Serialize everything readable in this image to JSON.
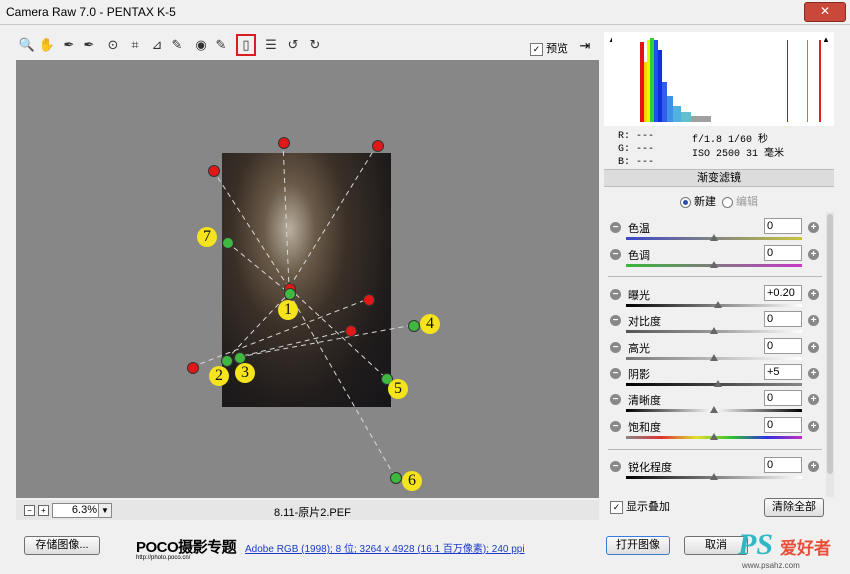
{
  "window": {
    "title": "Camera Raw 7.0 -  PENTAX K-5",
    "close_glyph": "✕"
  },
  "toolbar": {
    "tools": [
      {
        "name": "zoom-tool",
        "glyph": "🔍"
      },
      {
        "name": "hand-tool",
        "glyph": "✋"
      },
      {
        "name": "white-balance-tool",
        "glyph": "✒"
      },
      {
        "name": "color-sampler-tool",
        "glyph": "✒"
      },
      {
        "name": "targeted-adjustment-tool",
        "glyph": "⊙"
      },
      {
        "name": "crop-tool",
        "glyph": "⌗"
      },
      {
        "name": "straighten-tool",
        "glyph": "⊿"
      },
      {
        "name": "spot-removal-tool",
        "glyph": "✎"
      },
      {
        "name": "red-eye-tool",
        "glyph": "◉"
      },
      {
        "name": "adjustment-brush-tool",
        "glyph": "✎"
      },
      {
        "name": "graduated-filter-tool",
        "glyph": "▯"
      },
      {
        "name": "preferences-tool",
        "glyph": "☰"
      },
      {
        "name": "rotate-ccw-tool",
        "glyph": "↺"
      },
      {
        "name": "rotate-cw-tool",
        "glyph": "↻"
      }
    ],
    "preview_label": "预览",
    "preview_checked": "✓",
    "fullscreen_glyph": "⇥"
  },
  "annotations": [
    "1",
    "2",
    "3",
    "4",
    "5",
    "6",
    "7"
  ],
  "status": {
    "zoom_minus": "−",
    "zoom_plus": "+",
    "zoom": "6.3%",
    "dropdown": "▼",
    "filename": "8.11-原片2.PEF"
  },
  "histogram": {
    "clip_shadow": "▲",
    "clip_highlight": "▲"
  },
  "info": {
    "r": "R:  ---",
    "g": "G:  ---",
    "b": "B:  ---",
    "exif_line1": "f/1.8   1/60 秒",
    "exif_line2": "ISO 2500   31 毫米"
  },
  "panel": {
    "title": "渐变滤镜",
    "mode_new": "新建",
    "mode_edit": "编辑"
  },
  "sliders": [
    {
      "label": "色温",
      "value": "0",
      "pos": 0.5,
      "track": "linear-gradient(90deg,#3c46c8,#c8c43c)"
    },
    {
      "label": "色调",
      "value": "0",
      "pos": 0.5,
      "track": "linear-gradient(90deg,#38b838,#c838c8)"
    },
    {
      "label": "曝光",
      "value": "+0.20",
      "pos": 0.525,
      "track": "linear-gradient(90deg,#000,#fff)"
    },
    {
      "label": "对比度",
      "value": "0",
      "pos": 0.5,
      "track": "linear-gradient(90deg,#555,#999,#fff)"
    },
    {
      "label": "高光",
      "value": "0",
      "pos": 0.5,
      "track": "linear-gradient(90deg,#777,#fff)"
    },
    {
      "label": "阴影",
      "value": "+5",
      "pos": 0.525,
      "track": "linear-gradient(90deg,#000,#888)"
    },
    {
      "label": "清晰度",
      "value": "0",
      "pos": 0.5,
      "track": "linear-gradient(90deg,#000,#fff,#000)"
    },
    {
      "label": "饱和度",
      "value": "0",
      "pos": 0.5,
      "track": "linear-gradient(90deg,#888,#e03030,#e0e030,#30c030,#3030e0,#c030c0)"
    },
    {
      "label": "锐化程度",
      "value": "0",
      "pos": 0.5,
      "track": "linear-gradient(90deg,#000,#fff)"
    }
  ],
  "overlay": {
    "show_label": "显示叠加",
    "checked": "✓",
    "clear_all": "清除全部"
  },
  "footer": {
    "save": "存储图像...",
    "poco_logo": "POCO摄影专题",
    "poco_url": "http://photo.poco.cn/",
    "workflow_link": "Adobe RGB (1998); 8 位; 3264 x 4928 (16.1 百万像素); 240 ppi",
    "open": "打开图像",
    "cancel": "取消"
  },
  "watermark": {
    "ps": "PS",
    "cn": "爱好者",
    "url": "www.psahz.com"
  }
}
